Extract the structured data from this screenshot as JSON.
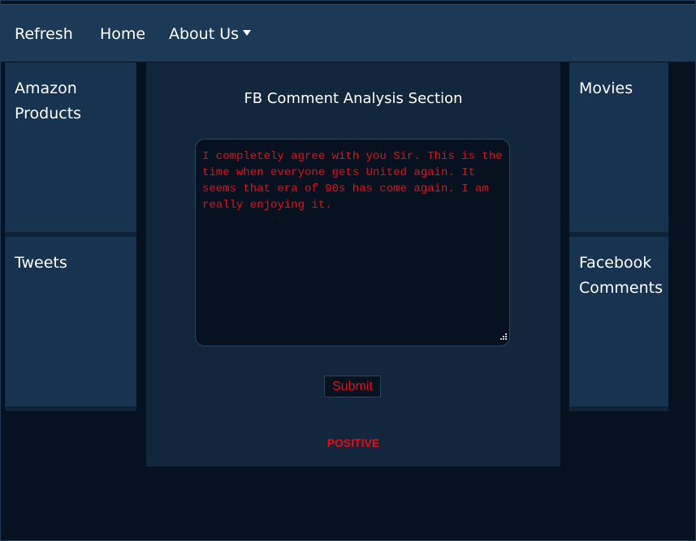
{
  "navbar": {
    "items": [
      {
        "label": "Refresh"
      },
      {
        "label": "Home"
      },
      {
        "label": "About Us"
      }
    ]
  },
  "sidebar_left": {
    "items": [
      {
        "label": "Amazon Products"
      },
      {
        "label": "Tweets"
      }
    ]
  },
  "sidebar_right": {
    "items": [
      {
        "label": "Movies"
      },
      {
        "label": "Facebook Comments"
      }
    ]
  },
  "main": {
    "title": "FB Comment Analysis Section",
    "comment_value": "I completely agree with you Sir. This is the time when everyone gets United again. It seems that era of 90s has come again. I am really enjoying it.",
    "submit_label": "Submit",
    "result": "POSITIVE"
  },
  "colors": {
    "navbar_bg": "#1c3a56",
    "panel_bg": "#12263c",
    "card_bg": "#183350",
    "page_bg": "#06121f",
    "accent_red": "#e0101a"
  },
  "icons": {
    "dropdown": "caret-down-icon",
    "textarea_resize": "resize-grip-icon"
  }
}
